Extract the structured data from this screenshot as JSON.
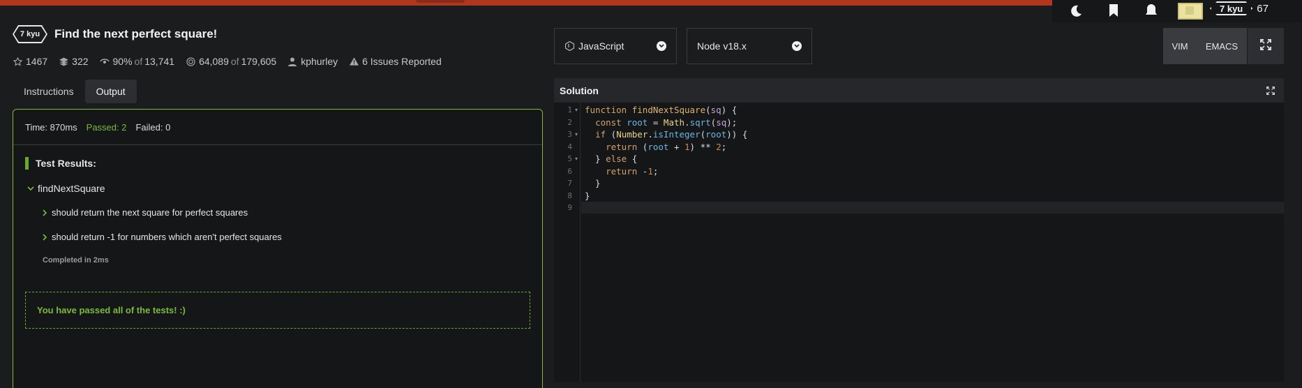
{
  "top_bar": {
    "icons": [
      "moon-icon",
      "bookmark-icon",
      "bell-icon"
    ],
    "rank": "7 kyu",
    "honor_partial": "67",
    "accent": "#b1361e"
  },
  "kata": {
    "rank": "7 kyu",
    "title": "Find the next perfect square!"
  },
  "stats": {
    "stars": "1467",
    "collections": "322",
    "satisfaction_pct": "90%",
    "satisfaction_of": "of",
    "satisfaction_total": "13,741",
    "completions": "64,089",
    "completions_of": "of",
    "completions_total": "179,605",
    "author": "kphurley",
    "issues": "6 Issues Reported"
  },
  "tabs": [
    {
      "label": "Instructions",
      "active": false
    },
    {
      "label": "Output",
      "active": true
    }
  ],
  "output": {
    "time": "Time: 870ms",
    "passed": "Passed: 2",
    "failed": "Failed: 0",
    "results_heading": "Test Results:",
    "group": "findNextSquare",
    "tests": [
      "should return the next square for perfect squares",
      "should return -1 for numbers which aren't perfect squares"
    ],
    "completed": "Completed in 2ms",
    "pass_message": "You have passed all of the tests! :)",
    "pass_color": "#7bbb3b"
  },
  "editor_controls": {
    "language": "JavaScript",
    "runtime": "Node v18.x",
    "modes": [
      "VIM",
      "EMACS"
    ]
  },
  "solution": {
    "title": "Solution",
    "line_numbers": [
      "1",
      "2",
      "3",
      "4",
      "5",
      "6",
      "7",
      "8",
      "9"
    ],
    "lines": [
      "function findNextSquare(sq) {",
      "  const root = Math.sqrt(sq);",
      "  if (Number.isInteger(root)) {",
      "    return (root + 1) ** 2;",
      "  } else {",
      "    return -1;",
      "  }",
      "}",
      ""
    ]
  }
}
